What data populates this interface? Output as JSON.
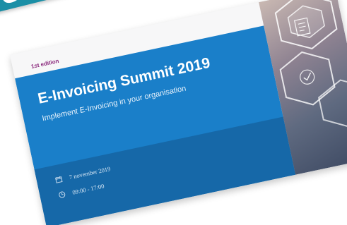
{
  "ribbon": {
    "text": "ess E-"
  },
  "card": {
    "edition": "1st edition",
    "title": "E-Invoicing Summit 2019",
    "subtitle": "Implement E-Invoicing in your organisation",
    "date": "7 november 2019",
    "time": "09:00 - 17:00"
  },
  "colors": {
    "ribbon": "#1b8fa6",
    "panel": "#1a7fc9",
    "info_band": "#1668a8",
    "edition": "#8b2a7d"
  },
  "icons": {
    "date": "calendar-icon",
    "time": "clock-icon"
  }
}
